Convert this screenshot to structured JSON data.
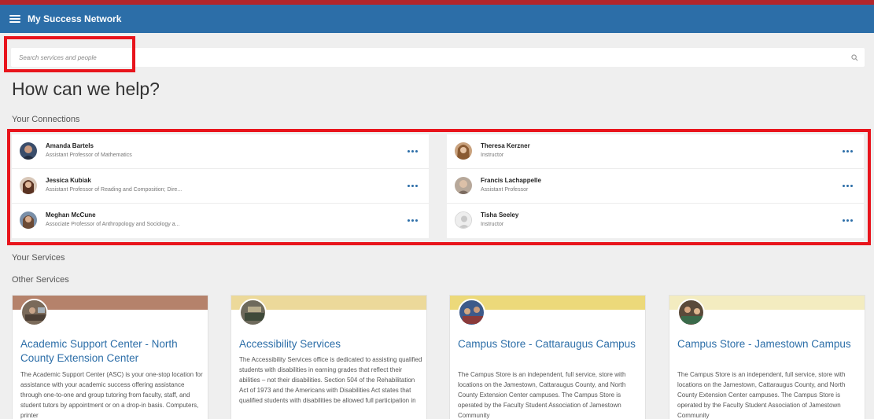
{
  "header": {
    "app_title": "My Success Network"
  },
  "search": {
    "placeholder": "Search services and people"
  },
  "page_title": "How can we help?",
  "sections": {
    "connections": "Your Connections",
    "your_services": "Your Services",
    "other_services": "Other Services"
  },
  "connections": [
    {
      "name": "Amanda Bartels",
      "role": "Assistant Professor of Mathematics"
    },
    {
      "name": "Jessica Kubiak",
      "role": "Assistant Professor of Reading and Composition; Dire..."
    },
    {
      "name": "Meghan McCune",
      "role": "Associate Professor of Anthropology and Sociology a..."
    },
    {
      "name": "Theresa Kerzner",
      "role": "Instructor"
    },
    {
      "name": "Francis Lachappelle",
      "role": "Assistant Professor"
    },
    {
      "name": "Tisha Seeley",
      "role": "Instructor"
    }
  ],
  "services": [
    {
      "title": "Academic Support Center - North County Extension Center",
      "band_color": "#b5826b",
      "description": "The Academic Support Center (ASC) is your one-stop location for assistance with your academic success offering assistance through one-to-one and group tutoring from faculty, staff, and student tutors by appointment or on a drop-in basis. Computers, printer"
    },
    {
      "title": "Accessibility Services",
      "band_color": "#ecd99a",
      "description": "The Accessibility Services office is dedicated to assisting qualified students with disabilities in earning grades that reflect their abilities – not their disabilities. Section 504 of the Rehabilitation Act of 1973 and the Americans with Disabilities Act states that qualified students with disabilities be allowed full participation in"
    },
    {
      "title": "Campus Store - Cattaraugus Campus",
      "band_color": "#ecd97a",
      "description": "The Campus Store is an independent, full service, store with locations on the Jamestown, Cattaraugus County, and North County Extension Center campuses. The Campus Store is operated by the Faculty Student Association of Jamestown Community"
    },
    {
      "title": "Campus Store - Jamestown Campus",
      "band_color": "#f3ecc0",
      "description": "The Campus Store is an independent, full service, store with locations on the Jamestown, Cattaraugus County, and North County Extension Center campuses. The Campus Store is operated by the Faculty Student Association of Jamestown Community"
    }
  ]
}
